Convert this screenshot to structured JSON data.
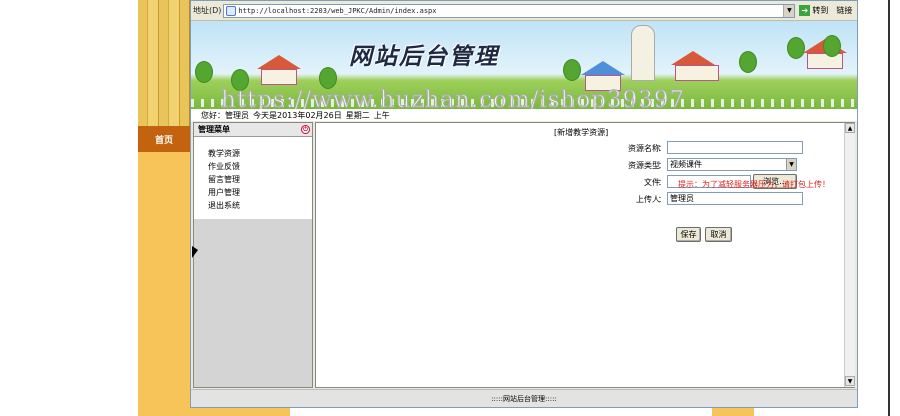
{
  "browser": {
    "address_label": "地址(D)",
    "url": "http://localhost:2203/web_JPKC/Admin/index.aspx",
    "go_label": "转到",
    "links_label": "链接"
  },
  "banner": {
    "title": "网站后台管理",
    "watermark": "https://www.huzhan.com/ishop39397"
  },
  "side": {
    "home_label": "首页"
  },
  "infobar": {
    "greeting": "您好：管理员",
    "date_text": "今天是2013年02月26日",
    "weekday": "星期二",
    "ampm": "上午"
  },
  "menu": {
    "header": "管理菜单",
    "items": [
      {
        "label": "教学资源"
      },
      {
        "label": "作业反馈"
      },
      {
        "label": "留言管理"
      },
      {
        "label": "用户管理"
      },
      {
        "label": "退出系统"
      }
    ]
  },
  "form": {
    "title": "[新增教学资源]",
    "name_label": "资源名称",
    "type_label": "资源类型",
    "file_label": "文件",
    "uploader_label": "上传人",
    "colon": "：",
    "name_value": "",
    "type_value": "视频课件",
    "uploader_value": "管理员",
    "browse_label": "浏览...",
    "hint": "提示：为了减轻服务器压力，请打包上传！",
    "save_label": "保存",
    "cancel_label": "取消"
  },
  "footer": {
    "text": ":::::网站后台管理:::::"
  }
}
